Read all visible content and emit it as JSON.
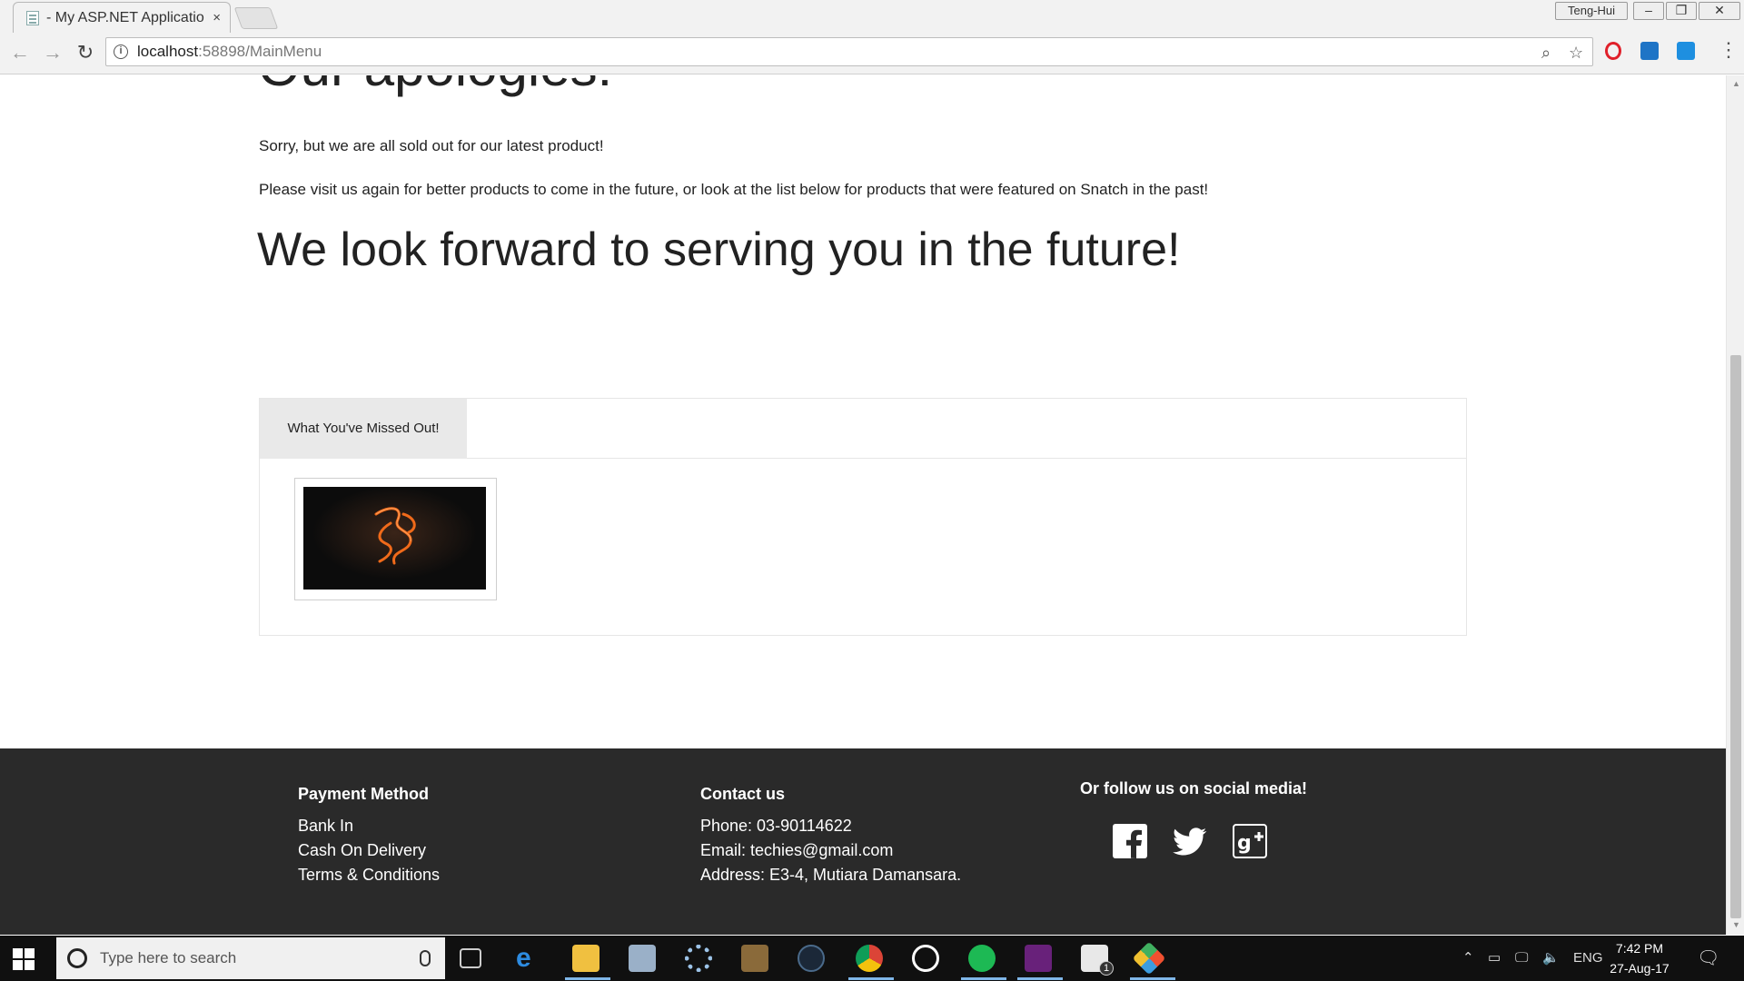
{
  "browser": {
    "tab_title": "- My ASP.NET Applicatio",
    "tab_close": "×",
    "user_name": "Teng-Hui",
    "url_host": "localhost",
    "url_path": ":58898/MainMenu",
    "info_icon": "i"
  },
  "page": {
    "heading_partial": "Our apologies!",
    "sold_out_text": "Sorry, but we are all sold out for our latest product!",
    "visit_text": "Please visit us again for better products to come in the future, or look at the list below for products that were featured on Snatch in the past!",
    "forward_text": "We look forward to serving you in the future!",
    "missed_tab": "What You've Missed Out!"
  },
  "footer": {
    "payment": {
      "title": "Payment Method",
      "items": [
        "Bank In",
        "Cash On Delivery",
        "Terms & Conditions"
      ]
    },
    "contact": {
      "title": "Contact us",
      "phone": "Phone: 03-90114622",
      "email": "Email: techies@gmail.com",
      "address": "Address: E3-4, Mutiara Damansara."
    },
    "social": {
      "title": "Or follow us on social media!",
      "icons": [
        "facebook-icon",
        "twitter-icon",
        "google-plus-icon"
      ]
    }
  },
  "taskbar": {
    "search_placeholder": "Type here to search",
    "language": "ENG",
    "time": "7:42 PM",
    "date": "27-Aug-17",
    "mail_badge": "1"
  },
  "colors": {
    "footer_bg": "#2a2a2a",
    "tab_bg": "#e9e9e9",
    "taskbar_bg": "#101010"
  }
}
